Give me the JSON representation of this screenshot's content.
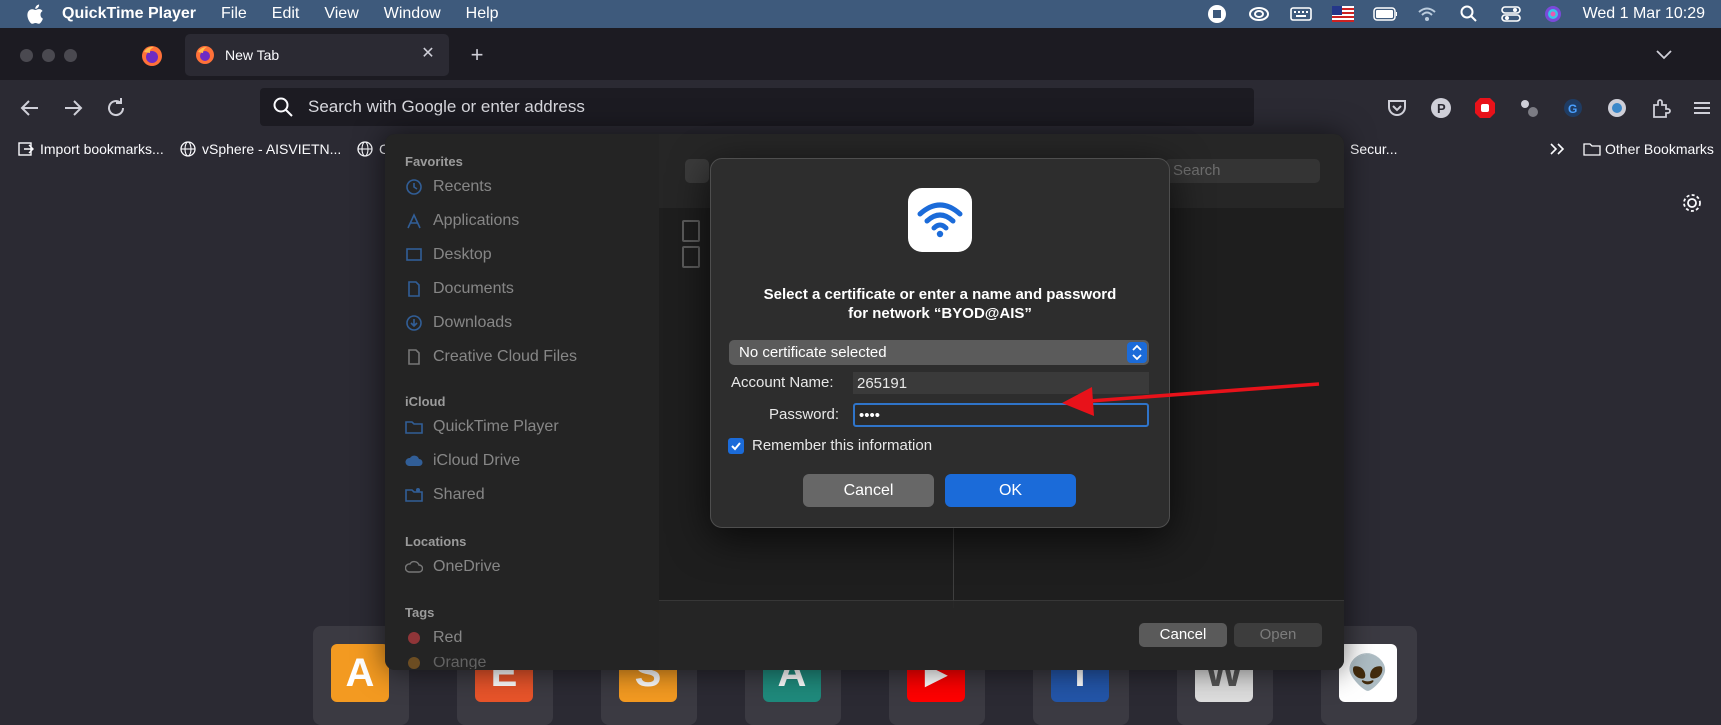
{
  "menubar": {
    "app_name": "QuickTime Player",
    "menus": [
      "File",
      "Edit",
      "View",
      "Window",
      "Help"
    ],
    "clock": "Wed 1 Mar  10:29"
  },
  "browser": {
    "tab_title": "New Tab",
    "url_placeholder": "Search with Google or enter address",
    "bookmarks": {
      "import": "Import bookmarks...",
      "vsphere": "vSphere - AISVIETN...",
      "partial": "C",
      "secur": "Secur...",
      "other": "Other Bookmarks"
    }
  },
  "open_dialog": {
    "sections": {
      "favorites": "Favorites",
      "icloud": "iCloud",
      "locations": "Locations",
      "tags": "Tags"
    },
    "favorites": [
      "Recents",
      "Applications",
      "Desktop",
      "Documents",
      "Downloads",
      "Creative Cloud Files"
    ],
    "icloud_items": [
      "QuickTime Player",
      "iCloud Drive",
      "Shared"
    ],
    "locations": [
      "OneDrive"
    ],
    "tags": [
      "Red",
      "Orange"
    ],
    "search_placeholder": "Search",
    "cancel_label": "Cancel",
    "open_label": "Open"
  },
  "wifi_dialog": {
    "title_line1": "Select a certificate or enter a name and password",
    "title_line2": "for network “BYOD@AIS”",
    "certificate": "No certificate selected",
    "account_label": "Account Name:",
    "account_value": "265191",
    "password_label": "Password:",
    "password_value": "••••",
    "remember_label": "Remember this information",
    "cancel_label": "Cancel",
    "ok_label": "OK",
    "accent_color": "#1b6bd9"
  },
  "shortcuts": [
    {
      "letter": "A",
      "color": "#f39a21"
    },
    {
      "letter": "E",
      "color": "#e8542a"
    },
    {
      "letter": "S",
      "color": "#f39a21"
    },
    {
      "letter": "A",
      "color": "#1f8a7c"
    },
    {
      "letter": "▶",
      "color": "#ff0000"
    },
    {
      "letter": "T",
      "color": "#2355a8"
    },
    {
      "letter": "W",
      "color": "#dddddd"
    },
    {
      "letter": "👽",
      "color": "#ffffff"
    }
  ],
  "annotation_color": "#e8121a"
}
